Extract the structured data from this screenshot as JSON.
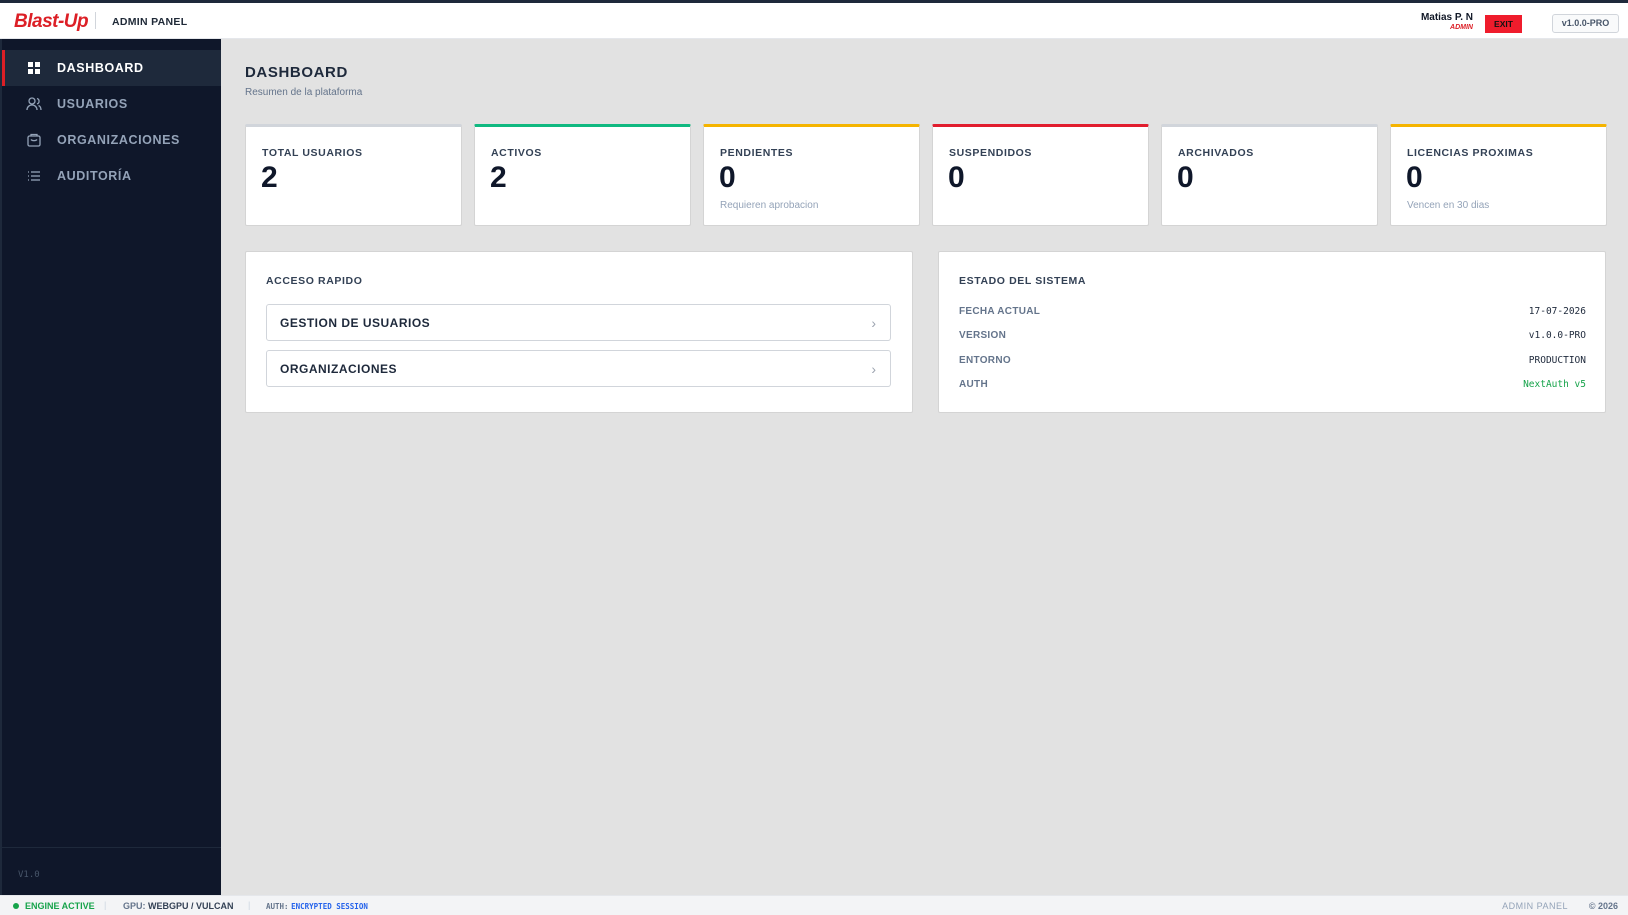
{
  "header": {
    "logo": "Blast-Up",
    "title": "ADMIN PANEL",
    "user_name": "Matias P. N",
    "user_role": "ADMIN",
    "exit_label": "EXIT",
    "version": "v1.0.0-PRO"
  },
  "sidebar": {
    "items": [
      {
        "label": "DASHBOARD",
        "icon": "grid-icon",
        "active": true
      },
      {
        "label": "USUARIOS",
        "icon": "users-icon",
        "active": false
      },
      {
        "label": "ORGANIZACIONES",
        "icon": "briefcase-icon",
        "active": false
      },
      {
        "label": "AUDITORÍA",
        "icon": "list-icon",
        "active": false
      }
    ],
    "version": "V1.0"
  },
  "main": {
    "title": "DASHBOARD",
    "subtitle": "Resumen de la plataforma",
    "stats": [
      {
        "label": "TOTAL USUARIOS",
        "value": "2",
        "hint": "",
        "accent": "#d1d5db"
      },
      {
        "label": "ACTIVOS",
        "value": "2",
        "hint": "",
        "accent": "#10b981"
      },
      {
        "label": "PENDIENTES",
        "value": "0",
        "hint": "Requieren aprobacion",
        "accent": "#f5b400"
      },
      {
        "label": "SUSPENDIDOS",
        "value": "0",
        "hint": "",
        "accent": "#e11d2e"
      },
      {
        "label": "ARCHIVADOS",
        "value": "0",
        "hint": "",
        "accent": "#d1d5db"
      },
      {
        "label": "LICENCIAS PROXIMAS",
        "value": "0",
        "hint": "Vencen en 30 dias",
        "accent": "#f5b400"
      }
    ],
    "quick_access": {
      "title": "ACCESO RAPIDO",
      "links": [
        {
          "label": "GESTION DE USUARIOS"
        },
        {
          "label": "ORGANIZACIONES"
        }
      ]
    },
    "system_status": {
      "title": "ESTADO DEL SISTEMA",
      "rows": [
        {
          "key": "FECHA ACTUAL",
          "value": "17-07-2026",
          "color": "#1e293b"
        },
        {
          "key": "VERSION",
          "value": "v1.0.0-PRO",
          "color": "#1e293b"
        },
        {
          "key": "ENTORNO",
          "value": "PRODUCTION",
          "color": "#1e293b"
        },
        {
          "key": "AUTH",
          "value": "NextAuth v5",
          "color": "#16a34a"
        }
      ]
    }
  },
  "footer": {
    "engine": "ENGINE ACTIVE",
    "gpu_label": "GPU:",
    "gpu_value": "WEBGPU / VULCAN",
    "auth_label": "AUTH:",
    "auth_value": "ENCRYPTED SESSION",
    "panel": "ADMIN PANEL",
    "copyright": "© 2026"
  },
  "colors": {
    "brand": "#dc1f26",
    "sidebar_bg": "#0f172a",
    "content_bg": "#e2e2e2",
    "engine_active": "#16a34a",
    "auth_value": "#2563eb"
  }
}
